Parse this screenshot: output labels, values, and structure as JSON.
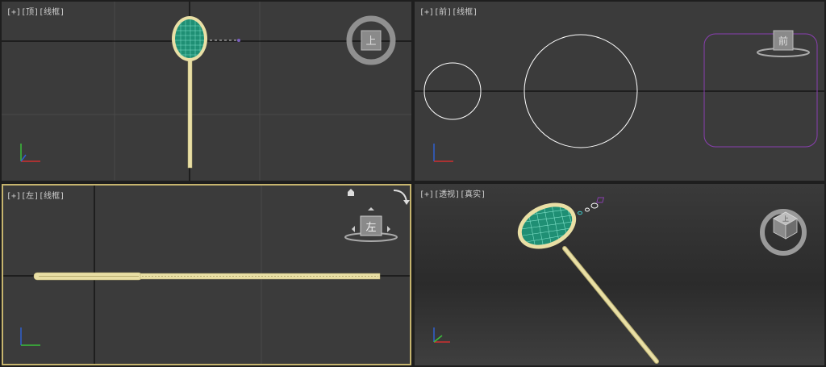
{
  "viewports": {
    "top": {
      "bracket_plus": "[+]",
      "view": "[顶]",
      "shading": "[线框]",
      "cube_face": "上"
    },
    "front": {
      "bracket_plus": "[+]",
      "view": "[前]",
      "shading": "[线框]",
      "cube_face": "前"
    },
    "left": {
      "bracket_plus": "[+]",
      "view": "[左]",
      "shading": "[线框]",
      "cube_face": "左"
    },
    "persp": {
      "bracket_plus": "[+]",
      "view": "[透视]",
      "shading": "[真实]",
      "cube_face": "上"
    }
  },
  "colors": {
    "viewport_bg": "#3b3b3b",
    "grid": "#4a4a4a",
    "axis_line": "#000000",
    "racket_frame": "#e9dfa5",
    "racket_net": "#1f8f74",
    "net_lines": "#7fe0c8",
    "selection_purple": "#8a3fb0",
    "active_border": "#c6b46e"
  },
  "icons": [
    "viewcube-icon",
    "axis-gizmo-icon",
    "home-icon",
    "orbit-arrow-icon"
  ]
}
